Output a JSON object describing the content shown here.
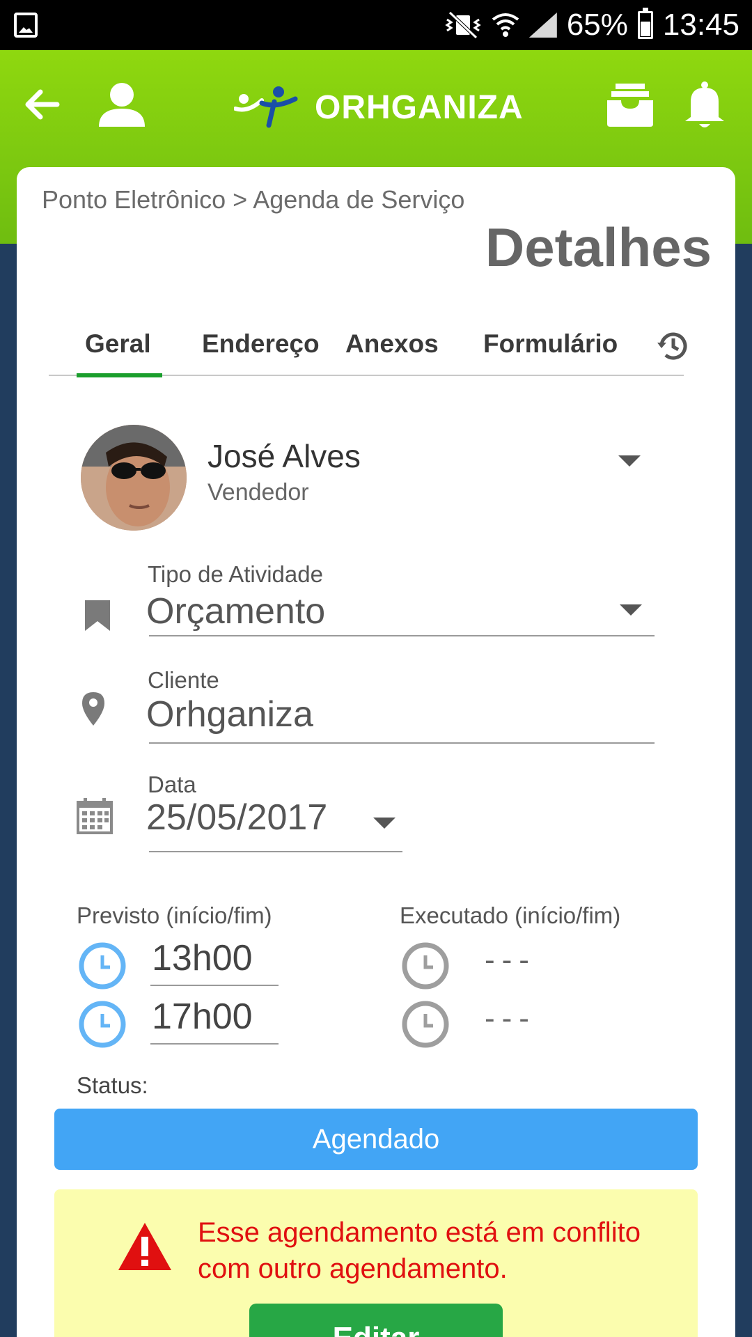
{
  "status_bar": {
    "battery": "65%",
    "time": "13:45"
  },
  "header": {
    "logo_text": "ORHGANIZA"
  },
  "breadcrumb": "Ponto Eletrônico > Agenda de Serviço",
  "page_title": "Detalhes",
  "tabs": [
    {
      "label": "Geral",
      "active": true
    },
    {
      "label": "Endereço",
      "active": false
    },
    {
      "label": "Anexos",
      "active": false
    },
    {
      "label": "Formulário",
      "active": false
    }
  ],
  "user": {
    "name": "José Alves",
    "role": "Vendedor"
  },
  "fields": {
    "activity_type": {
      "label": "Tipo de Atividade",
      "value": "Orçamento"
    },
    "client": {
      "label": "Cliente",
      "value": "Orhganiza"
    },
    "date": {
      "label": "Data",
      "value": "25/05/2017"
    }
  },
  "schedule": {
    "planned_label": "Previsto (início/fim)",
    "executed_label": "Executado (início/fim)",
    "planned_start": "13h00",
    "planned_end": "17h00",
    "executed_start": "---",
    "executed_end": "---"
  },
  "status": {
    "label": "Status:",
    "value": "Agendado",
    "color": "#42a5f5"
  },
  "alert": {
    "message": "Esse agendamento está em conflito com outro agendamento.",
    "button_label": "Editar"
  },
  "colors": {
    "header_green": "#8fd80f",
    "tab_active": "#1a9e2c",
    "alert_red": "#e01010",
    "alert_bg": "#fbfdae",
    "edit_green": "#27a745"
  }
}
